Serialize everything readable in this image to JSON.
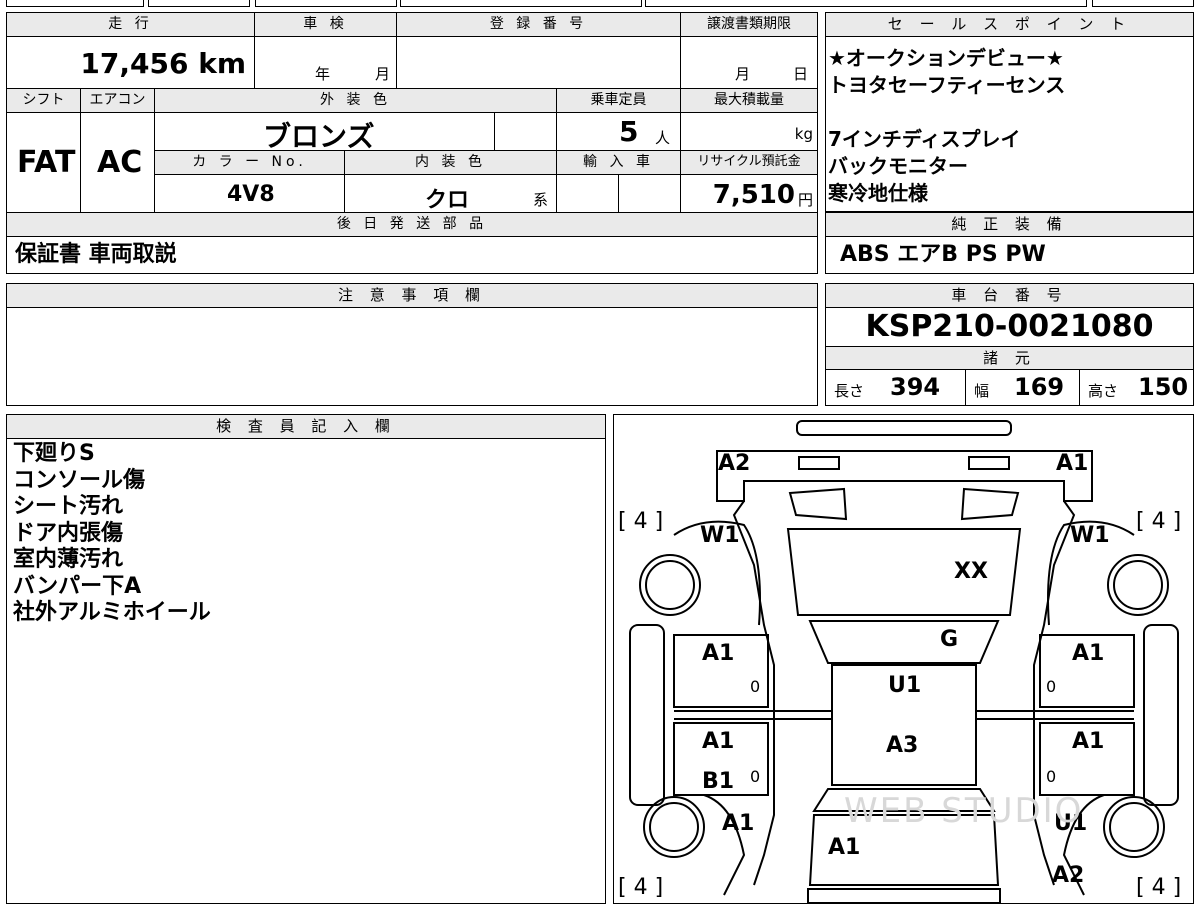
{
  "vehicle": {
    "mileage_label": "走 行",
    "mileage": "17,456 km",
    "inspection_label": "車 検",
    "inspection_year_unit": "年",
    "inspection_month_unit": "月",
    "registration_label": "登 録 番 号",
    "transfer_label": "譲渡書類期限",
    "transfer_month_unit": "月",
    "transfer_day_unit": "日",
    "shift_label": "シフト",
    "shift": "FAT",
    "ac_label": "エアコン",
    "ac": "AC",
    "exterior_label": "外 装 色",
    "exterior": "ブロンズ",
    "capacity_label": "乗車定員",
    "capacity": "5",
    "capacity_unit": "人",
    "max_load_label": "最大積載量",
    "max_load_unit": "kg",
    "color_no_label": "カ ラ ー No.",
    "color_no": "4V8",
    "interior_label": "内 装 色",
    "interior": "クロ",
    "interior_unit": "系",
    "import_label": "輸 入 車",
    "recycle_label": "リサイクル預託金",
    "recycle": "7,510",
    "recycle_unit": "円"
  },
  "sales_points": {
    "label": "セ ー ル ス ポ イ ン ト",
    "lines": [
      "★オークションデビュー★",
      "トヨタセーフティーセンス",
      "",
      "7インチディスプレイ",
      "バックモニター",
      "寒冷地仕様"
    ]
  },
  "deferred": {
    "label": "後 日 発 送 部 品",
    "value": "保証書 車両取説"
  },
  "equipment": {
    "label": "純 正 装 備",
    "value": "ABS エアB PS PW"
  },
  "notes": {
    "label": "注 意 事 項 欄"
  },
  "chassis": {
    "label": "車 台 番 号",
    "value": "KSP210-0021080",
    "specs_label": "諸 元",
    "length_label": "長さ",
    "length": "394",
    "width_label": "幅",
    "width": "169",
    "height_label": "高さ",
    "height": "150"
  },
  "inspector": {
    "label": "検 査 員 記 入 欄",
    "lines": [
      "下廻りS",
      "コンソール傷",
      "シート汚れ",
      "ドア内張傷",
      "室内薄汚れ",
      "バンパー下A",
      "社外アルミホイール"
    ]
  },
  "diagram": {
    "marks": {
      "front_left": "A2",
      "front_right": "A1",
      "tire_fl": "[ 4 ]",
      "tire_fr": "[ 4 ]",
      "tire_rl": "[ 4 ]",
      "tire_rr": "[ 4 ]",
      "fender_fl": "W1",
      "fender_fr": "W1",
      "hood": "XX",
      "windshield": "G",
      "roof": "U1",
      "rear_roof": "A3",
      "door_fl": "A1",
      "door_fr": "A1",
      "door_rl": "A1",
      "door_rr": "A1",
      "sill_rl": "B1",
      "rear_fender_l": "A1",
      "rear_fender_r": "U1",
      "tailgate": "A1",
      "rear_bumper_r": "A2",
      "zero": "0"
    },
    "watermark": "WEB STUDIO"
  }
}
